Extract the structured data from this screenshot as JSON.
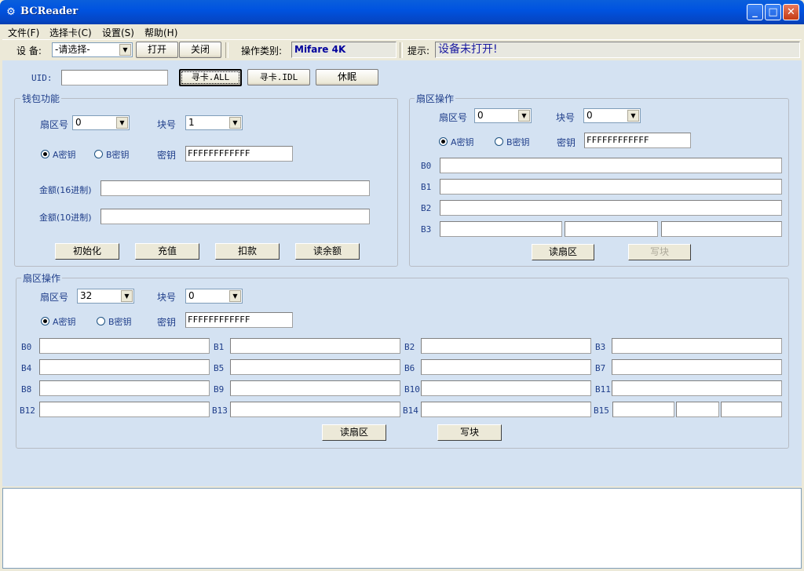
{
  "window": {
    "title": "BCReader",
    "minimize": "_",
    "maximize": "□",
    "close": "✕"
  },
  "menu": [
    "文件(F)",
    "选择卡(C)",
    "设置(S)",
    "帮助(H)"
  ],
  "toolbar": {
    "device_label": "设 备:",
    "device_value": "-请选择-",
    "open_label": "打开",
    "close_label": "关闭",
    "op_type_label": "操作类别:",
    "op_type_value": "Mifare 4K",
    "hint_label": "提示:",
    "hint_value": "设备未打开!"
  },
  "uid": {
    "label": "UID:",
    "value": ""
  },
  "buttons": {
    "find_all": "寻卡.ALL",
    "find_idl": "寻卡.IDL",
    "sleep": "休眠"
  },
  "wallet": {
    "title": "钱包功能",
    "sector_label": "扇区号",
    "sector_value": "0",
    "block_label": "块号",
    "block_value": "1",
    "key_a_label": "A密钥",
    "key_b_label": "B密钥",
    "key_label": "密钥",
    "key_value": "FFFFFFFFFFFF",
    "amount_hex_label": "金额(16进制)",
    "amount_hex_value": "",
    "amount_dec_label": "金额(10进制)",
    "amount_dec_value": "",
    "init_label": "初始化",
    "recharge_label": "充值",
    "deduct_label": "扣款",
    "balance_label": "读余额"
  },
  "sector_small": {
    "title": "扇区操作",
    "sector_label": "扇区号",
    "sector_value": "0",
    "block_label": "块号",
    "block_value": "0",
    "key_a_label": "A密钥",
    "key_b_label": "B密钥",
    "key_label": "密钥",
    "key_value": "FFFFFFFFFFFF",
    "block_labels": [
      "B0",
      "B1",
      "B2",
      "B3"
    ],
    "read_label": "读扇区",
    "write_label": "写块"
  },
  "sector_large": {
    "title": "扇区操作",
    "sector_label": "扇区号",
    "sector_value": "32",
    "block_label": "块号",
    "block_value": "0",
    "key_a_label": "A密钥",
    "key_b_label": "B密钥",
    "key_label": "密钥",
    "key_value": "FFFFFFFFFFFF",
    "block_labels": [
      "B0",
      "B1",
      "B2",
      "B3",
      "B4",
      "B5",
      "B6",
      "B7",
      "B8",
      "B9",
      "B10",
      "B11",
      "B12",
      "B13",
      "B14",
      "B15"
    ],
    "read_label": "读扇区",
    "write_label": "写块"
  }
}
